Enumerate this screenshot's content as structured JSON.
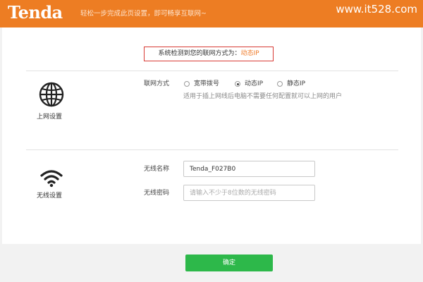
{
  "header": {
    "logo": "Tenda",
    "subtitle": "轻松一步完成此页设置，即可畅享互联网~",
    "watermark": "www.it528.com"
  },
  "detect": {
    "label": "系统检测到您的联网方式为：",
    "value": "动态IP"
  },
  "internet": {
    "section_label": "上网设置",
    "icon": "globe-icon",
    "field_label": "联网方式",
    "options": [
      {
        "label": "宽带拨号",
        "selected": false
      },
      {
        "label": "动态IP",
        "selected": true
      },
      {
        "label": "静态IP",
        "selected": false
      }
    ],
    "hint": "适用于插上网线后电脑不需要任何配置就可以上网的用户"
  },
  "wireless": {
    "section_label": "无线设置",
    "icon": "wifi-icon",
    "ssid_label": "无线名称",
    "ssid_value": "Tenda_F027B0",
    "password_label": "无线密码",
    "password_placeholder": "请输入不少于8位数的无线密码"
  },
  "footer": {
    "ok_label": "确定"
  },
  "colors": {
    "brand": "#ed7d23",
    "highlight": "#ef7c2b",
    "alert_border": "#d83a34",
    "confirm_button": "#2db84a"
  }
}
